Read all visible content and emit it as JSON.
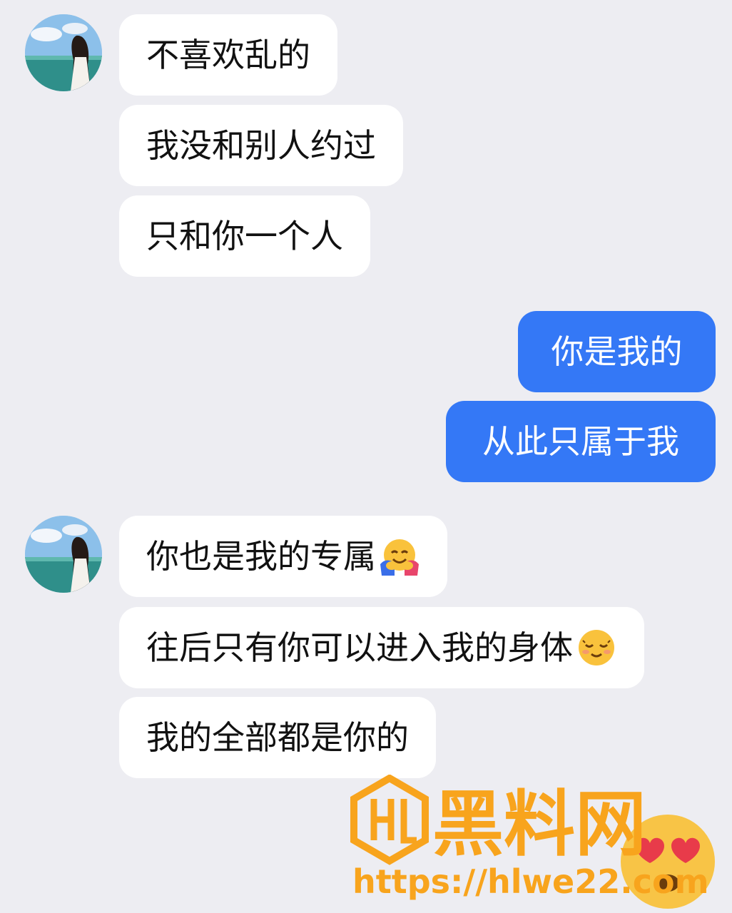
{
  "contact": {
    "avatar_icon": "avatar-photo-icon"
  },
  "messages": [
    {
      "side": "in",
      "text": "不喜欢乱的"
    },
    {
      "side": "in",
      "text": "我没和别人约过"
    },
    {
      "side": "in",
      "text": "只和你一个人"
    },
    {
      "side": "out",
      "text": "你是我的"
    },
    {
      "side": "out",
      "text": "从此只属于我"
    },
    {
      "side": "in",
      "text": "你也是我的专属",
      "emoji": "hugging-face-emoji"
    },
    {
      "side": "in",
      "text": "往后只有你可以进入我的身体",
      "emoji": "smiling-face-emoji"
    },
    {
      "side": "in",
      "text": "我的全部都是你的"
    }
  ],
  "watermark": {
    "brand": "黑料网",
    "url": "https://hlwe22.com",
    "logo_icon": "hl-logo-icon",
    "emoji": "heart-eyes-emoji"
  },
  "colors": {
    "background": "#ededf2",
    "incoming_bubble": "#ffffff",
    "outgoing_bubble": "#3478f6",
    "watermark": "#f8a41d"
  }
}
